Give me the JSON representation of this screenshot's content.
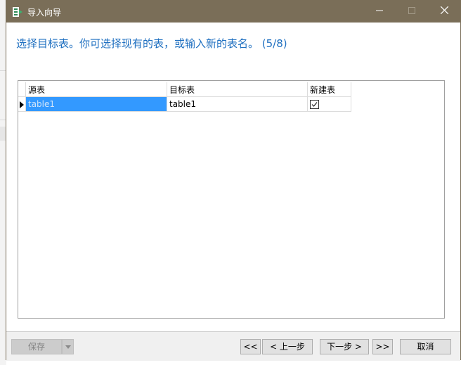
{
  "window": {
    "title": "导入向导"
  },
  "heading": "选择目标表。你可选择现有的表，或输入新的表名。 (5/8)",
  "grid": {
    "columns": [
      "源表",
      "目标表",
      "新建表"
    ],
    "rows": [
      {
        "source": "table1",
        "target": "table1",
        "new_table": true
      }
    ]
  },
  "footer": {
    "save_label": "保存",
    "first_label": "<<",
    "prev_label": "< 上一步",
    "next_label": "下一步 >",
    "last_label": ">>",
    "cancel_label": "取消"
  },
  "colors": {
    "titlebar": "#7a6e58",
    "heading": "#1e6fc0",
    "selection": "#3399ff"
  }
}
